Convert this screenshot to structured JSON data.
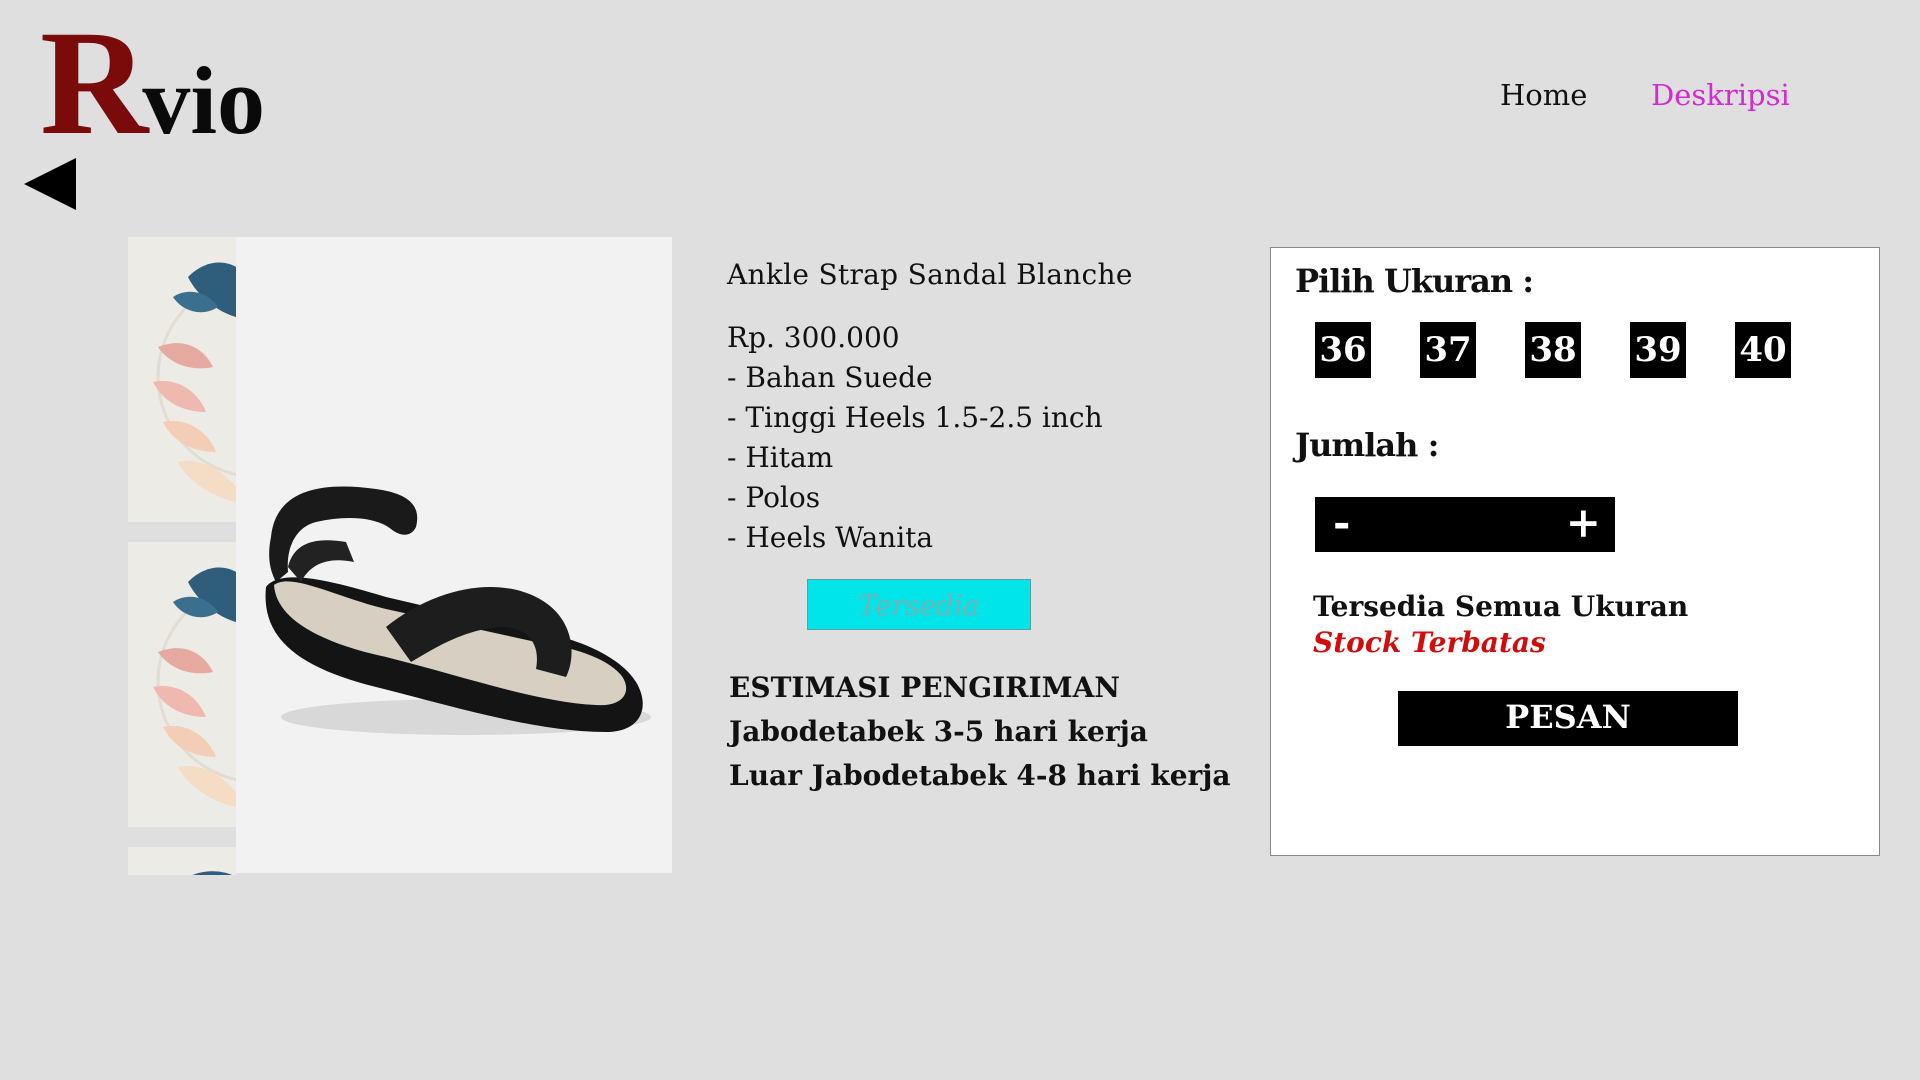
{
  "brand": {
    "logo_initial": "R",
    "logo_rest": "vio"
  },
  "nav": {
    "home": "Home",
    "description": "Deskripsi",
    "active_color": "#d32ad3"
  },
  "icons": {
    "back": "back-arrow-icon"
  },
  "product": {
    "name": "Ankle Strap Sandal Blanche",
    "specs": [
      "Rp. 300.000",
      "- Bahan Suede",
      "- Tinggi Heels 1.5-2.5 inch",
      "- Hitam",
      "- Polos",
      "- Heels Wanita"
    ],
    "availability_label": "Tersedia"
  },
  "shipping": {
    "title": "ESTIMASI PENGIRIMAN",
    "lines": [
      "Jabodetabek 3-5 hari kerja",
      "Luar Jabodetabek 4-8 hari kerja"
    ]
  },
  "order_panel": {
    "size_label": "Pilih Ukuran :",
    "sizes": [
      "36",
      "37",
      "38",
      "39",
      "40"
    ],
    "qty_label": "Jumlah :",
    "minus": "-",
    "plus": "+",
    "qty_value": "",
    "stock_all_sizes": "Tersedia Semua Ukuran",
    "stock_limited": "Stock Terbatas",
    "order_button": "PESAN"
  },
  "colors": {
    "background": "#e0dfe0",
    "logo_accent": "#7b0a0a",
    "availability_button": "#00e5ea",
    "stock_warning": "#d00c0c"
  }
}
